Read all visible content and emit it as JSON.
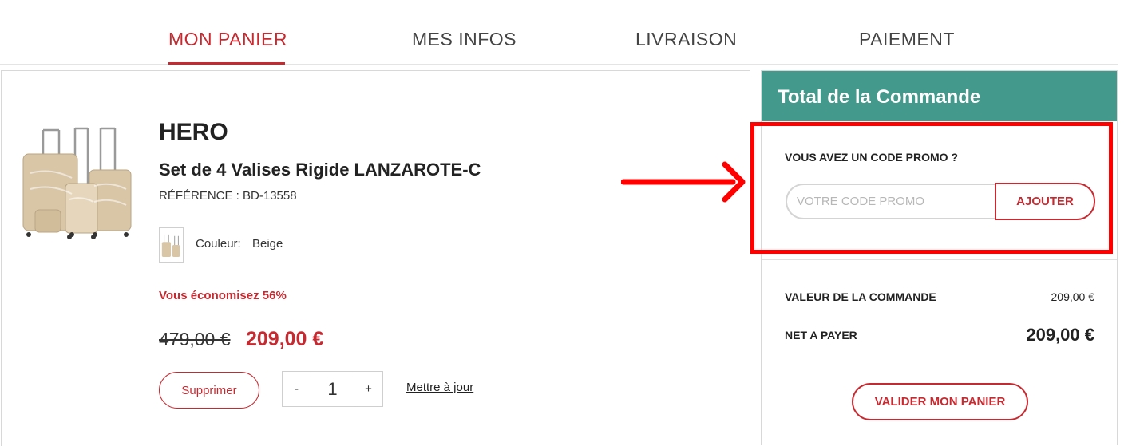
{
  "steps": {
    "cart": "MON PANIER",
    "info": "MES INFOS",
    "delivery": "LIVRAISON",
    "payment": "PAIEMENT"
  },
  "product": {
    "brand": "HERO",
    "name": "Set de 4 Valises Rigide LANZAROTE-C",
    "reference": "RÉFÉRENCE : BD-13558",
    "color_label": "Couleur:",
    "color_value": "Beige",
    "savings": "Vous économisez 56%",
    "old_price": "479,00 €",
    "new_price": "209,00 €",
    "remove_label": "Supprimer",
    "qty_minus": "-",
    "quantity": "1",
    "qty_plus": "+",
    "update_label": "Mettre à jour"
  },
  "summary": {
    "title": "Total de la Commande",
    "promo_label": "VOUS AVEZ UN CODE PROMO ?",
    "promo_placeholder": "VOTRE CODE PROMO",
    "promo_button": "AJOUTER",
    "order_value_label": "VALEUR DE LA COMMANDE",
    "order_value": "209,00 €",
    "net_label": "NET A PAYER",
    "net_value": "209,00 €",
    "validate_button": "VALIDER MON PANIER"
  },
  "colors": {
    "accent": "#c62a30",
    "header": "#42998c",
    "annotation": "#ff0000",
    "product": "#d9c6a7"
  }
}
